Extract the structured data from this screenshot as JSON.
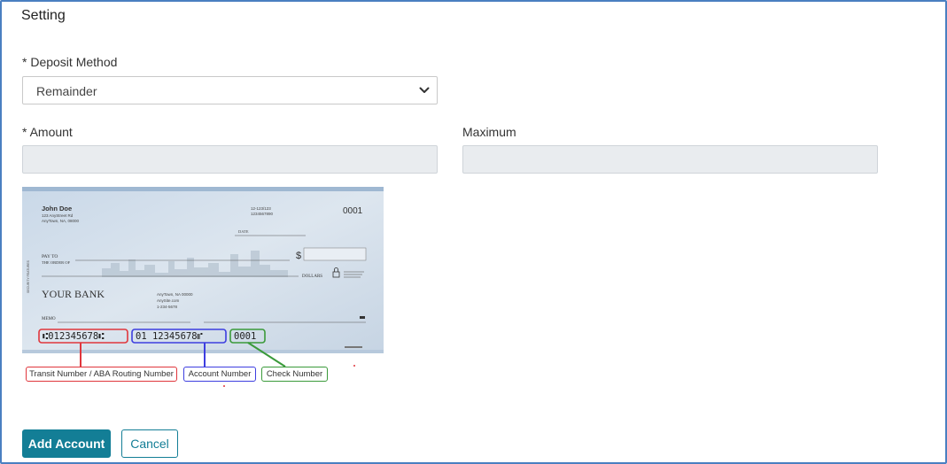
{
  "page": {
    "title": "Setting"
  },
  "form": {
    "deposit_method": {
      "label": "* Deposit Method",
      "value": "Remainder"
    },
    "amount": {
      "label": "* Amount",
      "value": ""
    },
    "maximum": {
      "label": "Maximum",
      "value": ""
    }
  },
  "check": {
    "name": "John Doe",
    "address_line1": "123 AnyStreet Rd",
    "address_line2": "AnyTown, NA, 08000",
    "fraction_line1": "12-123/123",
    "fraction_line2": "1234567890",
    "check_no": "0001",
    "date_label": "DATE",
    "pay_to_line1": "PAY TO",
    "pay_to_line2": "THE ORDER OF",
    "dollar_sign": "$",
    "dollars_label": "DOLLARS",
    "bank_name": "YOUR BANK",
    "bank_addr1": "AnyTown, NA 00000",
    "bank_addr2": "AnySite.com",
    "bank_addr3": "1-234-5678",
    "memo_label": "MEMO",
    "micr_routing": "⑆012345678⑆",
    "micr_account": "01 12345678⑈",
    "micr_check": "0001"
  },
  "legend": {
    "routing": "Transit Number / ABA Routing Number",
    "account": "Account Number",
    "check": "Check Number"
  },
  "colors": {
    "routing": "#e0363c",
    "account": "#3d3ee0",
    "check": "#3a9a3a",
    "accent": "#137e96"
  },
  "actions": {
    "add_label": "Add Account",
    "cancel_label": "Cancel"
  }
}
